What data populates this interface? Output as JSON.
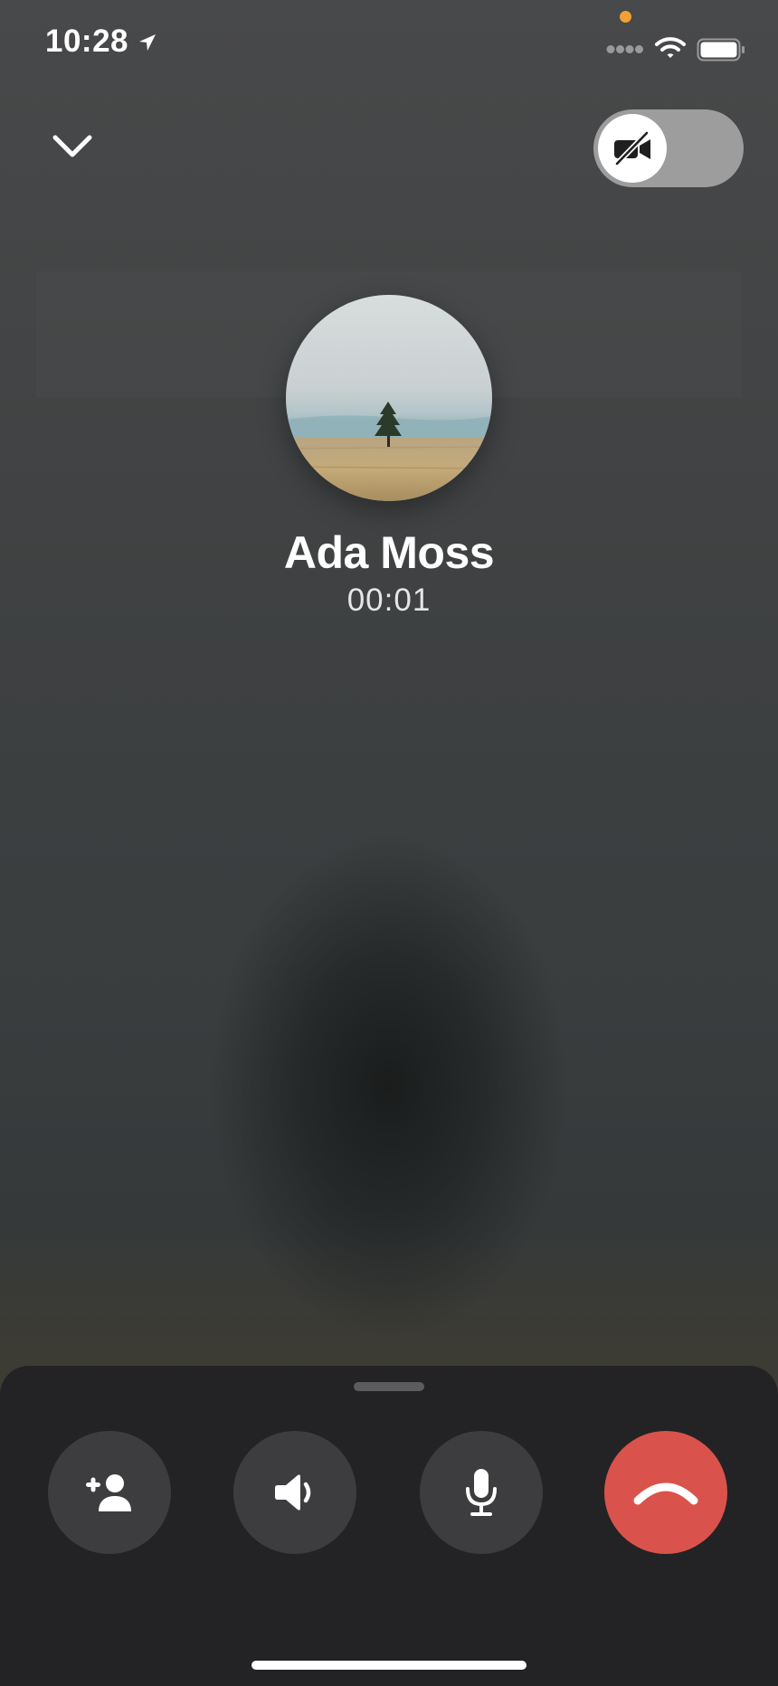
{
  "status_bar": {
    "time": "10:28",
    "icons": [
      "location-arrow-icon",
      "camera-in-use-indicator",
      "signal-icon",
      "wifi-icon",
      "battery-icon"
    ]
  },
  "top_controls": {
    "collapse_icon": "chevron-down-icon",
    "video_toggle": {
      "icon": "video-off-icon",
      "enabled": false
    }
  },
  "caller": {
    "name": "Ada Moss",
    "duration": "00:01",
    "avatar": "landscape-tree-photo"
  },
  "controls": [
    {
      "id": "add-participant",
      "icon": "add-person-icon"
    },
    {
      "id": "speaker",
      "icon": "speaker-icon"
    },
    {
      "id": "microphone",
      "icon": "microphone-icon"
    },
    {
      "id": "end-call",
      "icon": "hang-up-icon"
    }
  ],
  "colors": {
    "end_call": "#d9534c",
    "control_bg": "#3d3d3f",
    "panel_bg": "#232325",
    "indicator_dot": "#f0a035"
  }
}
